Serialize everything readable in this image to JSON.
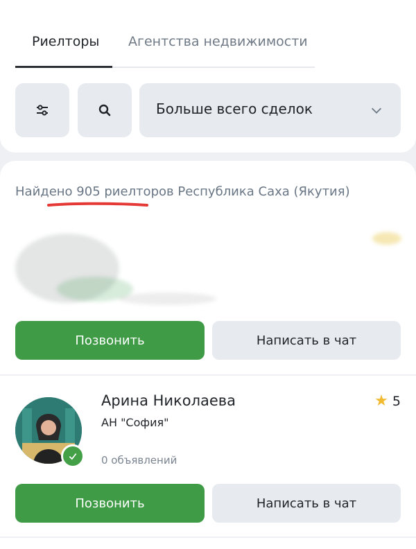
{
  "tabs": [
    {
      "label": "Риелторы"
    },
    {
      "label": "Агентства недвижимости"
    }
  ],
  "filters": {
    "sort_label": "Больше всего сделок"
  },
  "results": {
    "found_text": "Найдено 905 риелторов Республика Саха (Якутия)",
    "cards": [
      {
        "call_label": "Позвонить",
        "chat_label": "Написать в чат"
      },
      {
        "name": "Арина Николаева",
        "agency": "АН \"София\"",
        "listings": "0 объявлений",
        "rating": "5",
        "call_label": "Позвонить",
        "chat_label": "Написать в чат"
      }
    ]
  },
  "icons": {
    "filter": "sliders-icon",
    "search": "search-icon",
    "chevron": "chevron-down-icon",
    "star": "star-icon",
    "verified": "check-icon"
  },
  "colors": {
    "primary_green": "#3f9b45",
    "secondary_gray": "#e7ebf0",
    "highlight_red": "#e53935",
    "star_yellow": "#f0b92e"
  }
}
